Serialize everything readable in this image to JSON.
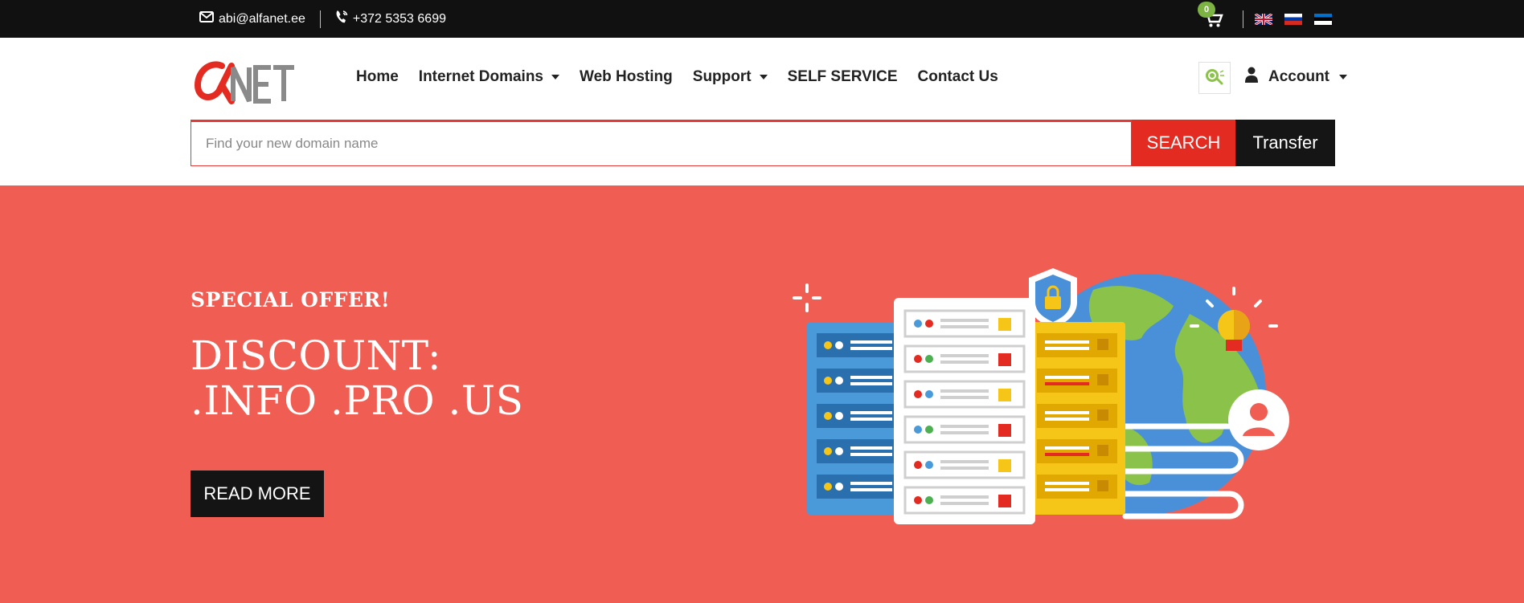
{
  "topbar": {
    "email": "abi@alfanet.ee",
    "phone": "+372 5353 6699",
    "cart_count": "0",
    "languages": [
      "English",
      "Russian",
      "Estonian"
    ]
  },
  "header": {
    "logo_alt": "alfaNET",
    "nav": [
      {
        "label": "Home",
        "has_dropdown": false
      },
      {
        "label": "Internet Domains",
        "has_dropdown": true
      },
      {
        "label": "Web Hosting",
        "has_dropdown": false
      },
      {
        "label": "Support",
        "has_dropdown": true
      },
      {
        "label": "SELF SERVICE",
        "has_dropdown": false
      },
      {
        "label": "Contact Us",
        "has_dropdown": false
      }
    ],
    "account_label": "Account"
  },
  "search": {
    "placeholder": "Find your new domain name",
    "value": "",
    "search_label": "SEARCH",
    "transfer_label": "Transfer"
  },
  "hero": {
    "kicker": "SPECIAL OFFER!",
    "title_line1": "DISCOUNT:",
    "title_line2": ".INFO .PRO .US",
    "cta_label": "READ MORE"
  },
  "colors": {
    "topbar_bg": "#111111",
    "accent_red": "#e32b22",
    "hero_bg": "#f05d52",
    "dark_button": "#141414",
    "cart_badge": "#7cb342"
  }
}
